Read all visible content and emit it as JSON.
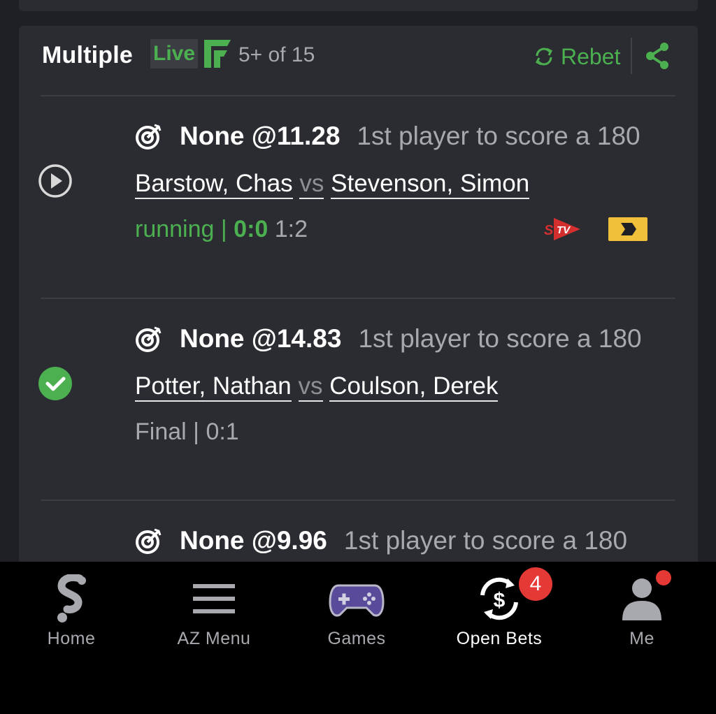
{
  "header": {
    "title": "Multiple",
    "live_label": "Live",
    "count": "5+ of 15",
    "rebet_label": "Rebet"
  },
  "bets": [
    {
      "status": "running",
      "pick": "None @11.28",
      "market": "1st player to score a 180",
      "player1": "Barstow, Chas",
      "vs": "vs",
      "player2": "Stevenson, Simon",
      "state_label": "running",
      "separator": "|",
      "score": "0:0",
      "set_score": "1:2"
    },
    {
      "status": "won",
      "pick": "None @14.83",
      "market": "1st player to score a 180",
      "player1": "Potter, Nathan",
      "vs": "vs",
      "player2": "Coulson, Derek",
      "state_label": "Final",
      "separator": "|",
      "score": "0:1"
    },
    {
      "pick": "None @9.96",
      "market": "1st player to score a 180"
    }
  ],
  "nav": {
    "items": [
      {
        "label": "Home",
        "icon": "home-s-icon"
      },
      {
        "label": "AZ Menu",
        "icon": "hamburger-icon"
      },
      {
        "label": "Games",
        "icon": "gamepad-icon"
      },
      {
        "label": "Open Bets",
        "icon": "open-bets-icon",
        "badge": "4"
      },
      {
        "label": "Me",
        "icon": "user-icon"
      }
    ],
    "active": "Open Bets"
  },
  "colors": {
    "accent_green": "#4caf50",
    "badge_red": "#e53935",
    "card_bg": "#2a2c31",
    "page_bg": "#1f2023"
  }
}
